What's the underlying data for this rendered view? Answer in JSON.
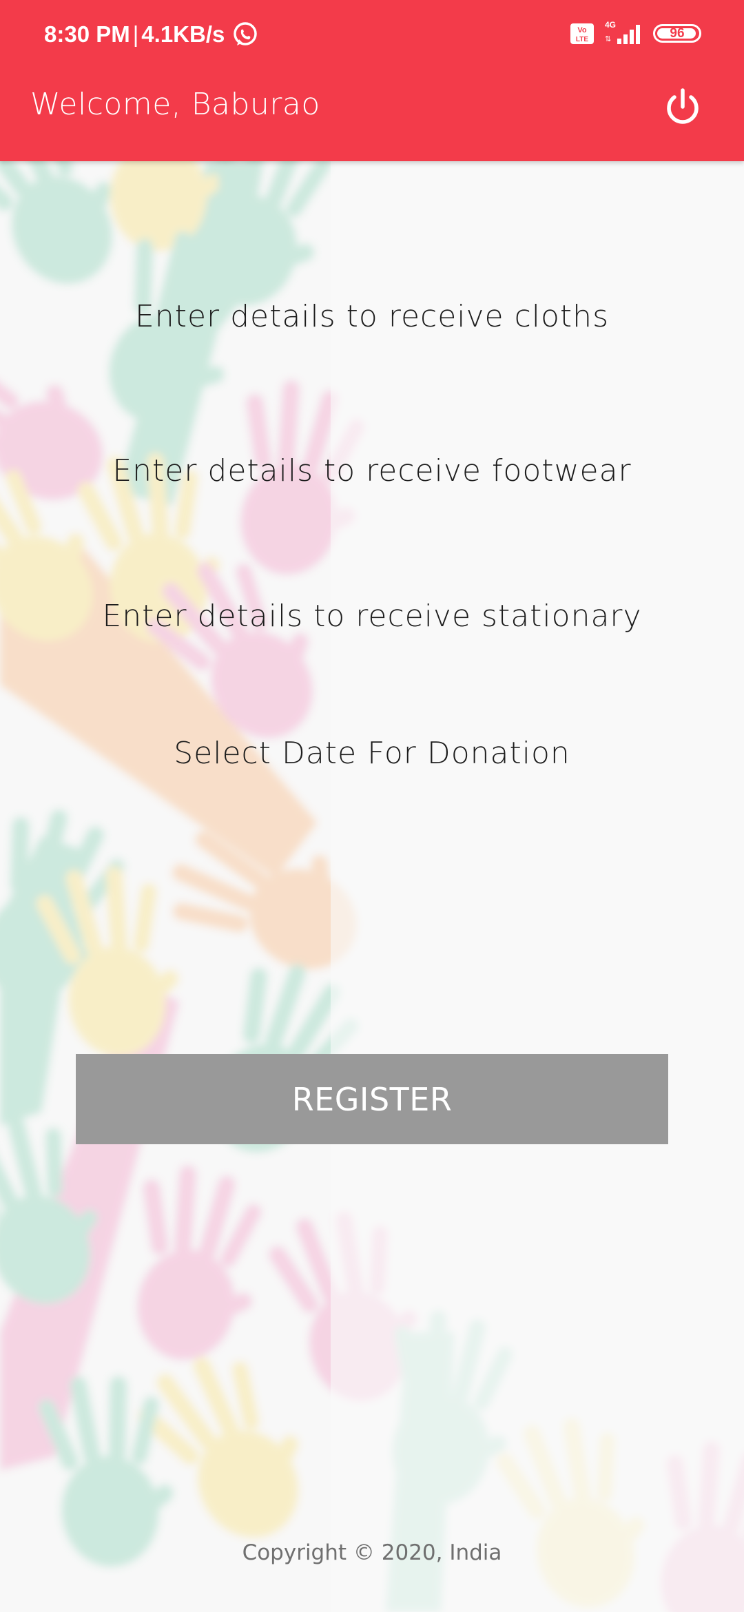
{
  "status_bar": {
    "time": "8:30 PM",
    "separator": "|",
    "network_speed": "4.1KB/s",
    "network_type": "4G",
    "battery_level": "96",
    "battery_fraction": 0.96,
    "icons": [
      "whatsapp-icon",
      "volte-icon",
      "signal-icon",
      "battery-icon"
    ]
  },
  "toolbar": {
    "title": "Welcome, Baburao",
    "power_icon": "power-icon",
    "color": "#f33b4a"
  },
  "options": [
    {
      "label": "Enter details to receive cloths"
    },
    {
      "label": "Enter details to receive footwear"
    },
    {
      "label": "Enter details to receive stationary"
    },
    {
      "label": "Select Date For Donation"
    }
  ],
  "register": {
    "label": "REGISTER",
    "color": "#999999"
  },
  "footer": {
    "copyright": "Copyright © 2020, India"
  },
  "background": {
    "art": "colorful-hands-illustration",
    "colors": [
      "#9fd6c2",
      "#f5c1da",
      "#f9e7a3",
      "#f4b39a",
      "#7fa88e"
    ]
  }
}
